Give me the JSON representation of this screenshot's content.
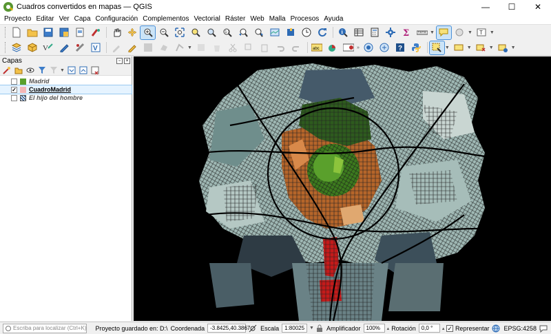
{
  "window": {
    "title": "Cuadros convertidos en mapas — QGIS",
    "minimize": "—",
    "maximize": "☐",
    "close": "✕"
  },
  "menu": [
    "Proyecto",
    "Editar",
    "Ver",
    "Capa",
    "Configuración",
    "Complementos",
    "Vectorial",
    "Ráster",
    "Web",
    "Malla",
    "Procesos",
    "Ayuda"
  ],
  "layers_panel": {
    "title": "Capas",
    "layers": [
      {
        "name": "Madrid",
        "checked": false,
        "swatch": "#5aa02c"
      },
      {
        "name": "CuadroMadrid",
        "checked": true,
        "swatch": "#f4b6b6"
      },
      {
        "name": "El hijo del hombre",
        "checked": false,
        "swatch": "raster"
      }
    ]
  },
  "toolbar_icons": [
    "new-project",
    "open",
    "save",
    "save-as",
    "print-layout",
    "style-manager",
    "pan",
    "pan-to-selection",
    "zoom-in",
    "zoom-out",
    "zoom-full",
    "zoom-selection",
    "zoom-layer",
    "zoom-native",
    "zoom-last",
    "zoom-next",
    "new-map-view",
    "new-3d-view",
    "temporal",
    "refresh",
    "identify",
    "attribute-table",
    "field-calculator",
    "statistics",
    "measure",
    "map-tips",
    "select",
    "annotations"
  ],
  "statusbar": {
    "locator_placeholder": "Escriba para localizar (Ctrl+K)",
    "message": "Proyecto guardado en: D:\\",
    "coord_label": "Coordenada",
    "coord_value": "-3.8425,40.3867",
    "scale_label": "Escala",
    "scale_value": "1:80025",
    "magnifier_label": "Amplificador",
    "magnifier_value": "100%",
    "rotation_label": "Rotación",
    "rotation_value": "0,0 °",
    "render_label": "Representar",
    "render_checked": true,
    "crs": "EPSG:4258"
  }
}
